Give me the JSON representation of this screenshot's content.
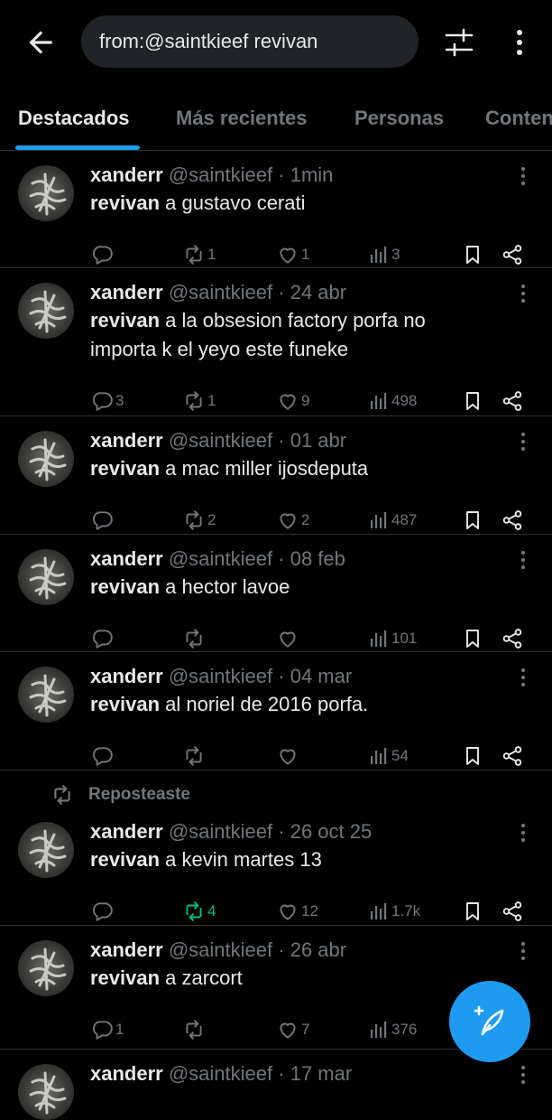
{
  "search": {
    "query": "from:@saintkieef revivan"
  },
  "tabs": [
    "Destacados",
    "Más recientes",
    "Personas",
    "Contenido"
  ],
  "colors": {
    "accent": "#1d9bf0",
    "repost_green": "#00ba7c",
    "muted": "#71767b",
    "background": "#000000"
  },
  "icons": [
    "back-arrow-icon",
    "filter-sliders-icon",
    "more-vertical-icon",
    "reply-icon",
    "repost-icon",
    "like-icon",
    "views-icon",
    "bookmark-icon",
    "share-icon",
    "compose-feather-icon"
  ],
  "tweets": [
    {
      "name": "xanderr",
      "handle": "@saintkieef",
      "dot": "·",
      "time": "1min",
      "bold": "revivan",
      "text": " a gustavo cerati",
      "replies": "",
      "reposts": "1",
      "likes": "1",
      "views": "3"
    },
    {
      "name": "xanderr",
      "handle": "@saintkieef",
      "dot": "·",
      "time": "24 abr",
      "bold": "revivan",
      "text": " a la obsesion factory porfa no importa k el yeyo este funeke",
      "replies": "3",
      "reposts": "1",
      "likes": "9",
      "views": "498"
    },
    {
      "name": "xanderr",
      "handle": "@saintkieef",
      "dot": "·",
      "time": "01 abr",
      "bold": "revivan",
      "text": " a mac miller ijosdeputa",
      "replies": "",
      "reposts": "2",
      "likes": "2",
      "views": "487"
    },
    {
      "name": "xanderr",
      "handle": "@saintkieef",
      "dot": "·",
      "time": "08 feb",
      "bold": "revivan",
      "text": " a hector lavoe",
      "replies": "",
      "reposts": "",
      "likes": "",
      "views": "101"
    },
    {
      "name": "xanderr",
      "handle": "@saintkieef",
      "dot": "·",
      "time": "04 mar",
      "bold": "revivan",
      "text": " al noriel de 2016 porfa.",
      "replies": "",
      "reposts": "",
      "likes": "",
      "views": "54"
    },
    {
      "name": "xanderr",
      "handle": "@saintkieef",
      "dot": "·",
      "time": "26 oct 25",
      "bold": "revivan",
      "text": " a kevin martes 13",
      "replies": "",
      "reposts": "4",
      "likes": "12",
      "views": "1.7k",
      "social_context": "Reposteaste"
    },
    {
      "name": "xanderr",
      "handle": "@saintkieef",
      "dot": "·",
      "time": "26 abr",
      "bold": "revivan",
      "text": " a zarcort",
      "replies": "1",
      "reposts": "",
      "likes": "7",
      "views": "376"
    },
    {
      "name": "xanderr",
      "handle": "@saintkieef",
      "dot": "·",
      "time": "17 mar"
    }
  ]
}
